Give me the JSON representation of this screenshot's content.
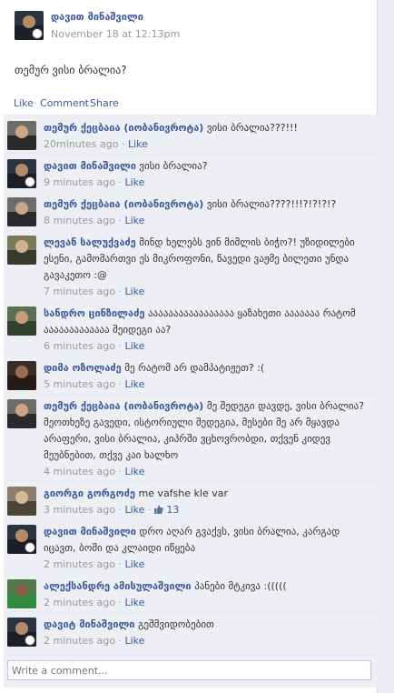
{
  "post": {
    "author": "დავით მინაშვილი",
    "timestamp": "November 18 at 12:13pm",
    "text": "თემურ ვისი ბრალია?",
    "actions": {
      "like": "Like",
      "comment": "Comment",
      "share": "Share",
      "separator": "·"
    }
  },
  "comments": [
    {
      "author": "თემურ ქეცბაია (იობანივროტა)",
      "text": "ვისი ბრალია???!!!",
      "time": "20minutes ago",
      "like_label": "Like",
      "separator": "·",
      "avatar": "avatar-temur"
    },
    {
      "author": "დავით მინაშვილი",
      "text": "ვისი ბრალია?",
      "time": "9 minutes ago",
      "like_label": "Like",
      "separator": "·",
      "avatar": "avatar-davit"
    },
    {
      "author": "თემურ ქეცბაია (იობანივროტა)",
      "text": "ვისი ბრალია????!!!?!?!?!?",
      "time": "8 minutes ago",
      "like_label": "Like",
      "separator": "·",
      "avatar": "avatar-temur"
    },
    {
      "author": "ლევან სალუქვაძე",
      "text": "მინდ ხელებს ვინ მიმლის ბიჭო?! უზიდილები ესენი, გამომართვი ეს მიკროფონი, წავედი ვაჟმე ბილეთი უნდა გავაკეთო :@",
      "time": "7 minutes ago",
      "like_label": "Like",
      "separator": "·",
      "avatar": "avatar-levan"
    },
    {
      "author": "სანდრო ცინზილაძე",
      "text": "ააააააააააააააააა ყაზახეთი ააააააა რატომ ააააააააააააა შეიდეგი აა?",
      "time": "6 minutes ago",
      "like_label": "Like",
      "separator": "·",
      "avatar": "avatar-sandro"
    },
    {
      "author": "დიმა ოზოლაძე",
      "text": "მე რატომ არ დამპატიჟეთ? :(",
      "time": "5 minutes ago",
      "like_label": "Like",
      "separator": "·",
      "avatar": "avatar-dima"
    },
    {
      "author": "თემურ ქეცბაია (იობანივროტა)",
      "text": "მე შედეგი დავდე, ვისი ბრალია? მეოთხეზე გავედი, ისტორიული შედეგია, მესები მე არ მყავდა არაფერი, ვისი ბრალია, კიპრში ვცხოვრობდი, თქვენ კიდევ მეუბნებით, თქვე კაი ხალხო",
      "time": "4 minutes ago",
      "like_label": "Like",
      "separator": "·",
      "avatar": "avatar-temur"
    },
    {
      "author": "გიორგი გორგოძე",
      "text": "me vafshe kle var",
      "time": "3 minutes ago",
      "like_label": "Like",
      "separator": "·",
      "likes": "13",
      "avatar": "avatar-giorgi"
    },
    {
      "author": "დავით მინაშვილი",
      "text": "დრო აღარ გვაქვს, ვისი ბრალია, კარგად იცავთ, ბოში და კლაიდი იწყება",
      "time": "2 minutes ago",
      "like_label": "Like",
      "separator": "·",
      "avatar": "avatar-davit"
    },
    {
      "author": "ალექსანდრე ამისულაშვილი",
      "text": "პანები მტკივა :(((((",
      "time": "2 minutes ago",
      "like_label": "Like",
      "separator": "·",
      "avatar": "avatar-aleksandre"
    },
    {
      "author": "დავიტ მინაშვილი",
      "text": "გეშმვიდობებით",
      "time": "2 minutes ago",
      "like_label": "Like",
      "separator": "·",
      "avatar": "avatar-davit"
    }
  ],
  "write_comment": {
    "placeholder": "Write a comment..."
  },
  "colors": {
    "link": "#3b5998",
    "comment_bg": "#edeff4",
    "meta": "#999999"
  }
}
